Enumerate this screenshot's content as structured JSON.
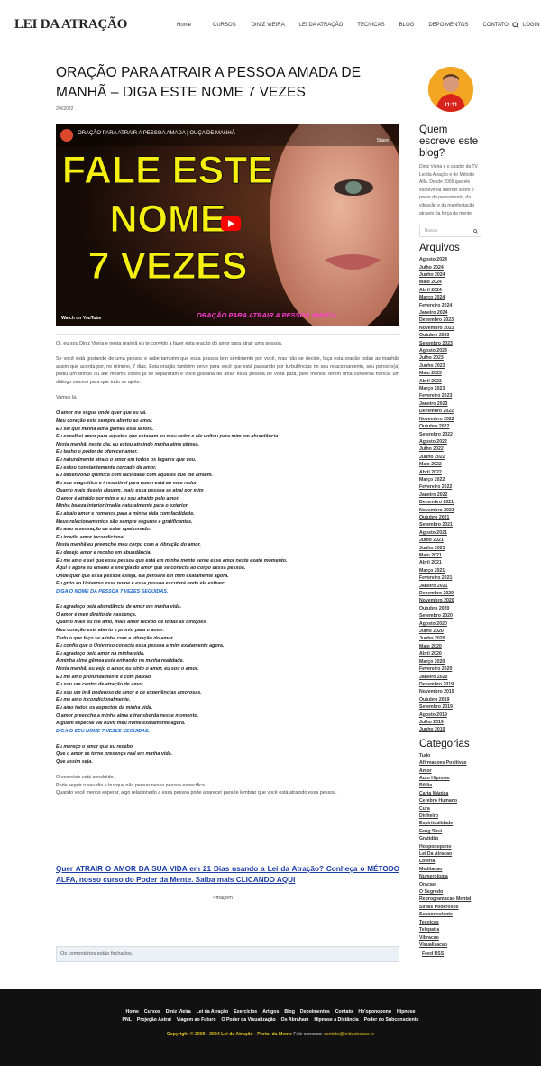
{
  "header": {
    "logo": "LEI DA ATRAÇÃO",
    "nav": [
      "Home",
      "CURSOS",
      "DINIZ VIEIRA",
      "LEI DA ATRAÇÃO",
      "TECNICAS",
      "BLOG",
      "DEPOIMENTOS",
      "CONTATO",
      "LOGIN"
    ],
    "search_icon": "search-icon"
  },
  "article": {
    "title": "ORAÇÃO PARA ATRAIR A PESSOA AMADA DE MANHÃ – DIGA ESTE NOME 7 VEZES",
    "date": "2/4/2022",
    "video": {
      "channel_title": "ORAÇÃO PARA ATRAIR A PESSOA AMADA | OUÇA DE MANHÃ",
      "share": "Share",
      "big_lines": [
        "FALE ESTE",
        "NOME",
        "7 VEZES"
      ],
      "watch_on": "Watch on",
      "youtube": "YouTube",
      "subtitle": "ORAÇÃO PARA ATRAIR A PESSOA AMADA"
    },
    "paragraphs": [
      "Oi, eu sou Diniz Vieira e nesta manhã eu te convido a fazer esta oração do amor para atrair uma pessoa.",
      "Se você está gostando de uma pessoa e sabe também que essa pessoa tem sentimento por você, mas não se decide, faça esta oração todas as manhãs assim que acorda por, no mínimo, 7 dias. Esta oração também serve para você que está passando por turbulências no seu relacionamento, seu parceiro(a) pediu um tempo ou até mesmo vocês já se separaram e você gostaria de atrair essa pessoa de volta para, pelo menos, terem uma conversa franca, um diálogo sincero para que tudo se ajeite.",
      "Vamos lá."
    ],
    "prayer1": [
      "O amor me segue onde quer que eu vá.",
      "Meu coração está sempre aberto ao amor.",
      "Eu sei que minha alma gêmea está lá fora.",
      "Eu espalhei amor para aqueles que estavam ao meu redor e ele voltou para mim em abundância.",
      "Nesta manhã, neste dia, eu estou atraindo minha alma gêmea.",
      "Eu tenho o poder de oferecer amor.",
      "Eu naturalmente atraio o amor em todos os lugares que vou.",
      "Eu estou constantemente cercado de amor.",
      "Eu desenvolvo química com facilidade com aqueles que me atraem.",
      "Eu sou magnético e irresistível para quem está ao meu redor.",
      "Quanto mais desejo alguém, mais essa pessoa se atrai por mim",
      "O amor é atraído por mim e eu sou atraído pelo amor.",
      "Minha beleza interior irradia naturalmente para o exterior.",
      "Eu atraio amor e romance para a minha vida com facilidade.",
      "Meus relacionamentos são sempre seguros e gratificantes.",
      "Eu amo a sensação de estar apaixonado.",
      "Eu irradio amor incondicional.",
      "Nesta manhã eu preencho meu corpo com a vibração do amor.",
      "Eu desejo amor e recebo em abundância.",
      "Eu me amo e sei que essa pessoa que está em minha mente sente esse amor neste exato momento.",
      "Aqui e agora eu emano a energia do amor que se conecta ao corpo dessa pessoa.",
      "Onde quer que essa pessoa esteja, ela pensará em mim exatamente agora.",
      "Eu grito ao Universo esse nome e essa pessoa escutará onde ela estiver:"
    ],
    "prayer1_blue": "DIGA O NOME DA PESSOA 7 VEZES SEGUIDAS.",
    "prayer2": [
      "Eu agradeço pela abundância de amor em minha vida.",
      "O amor é meu direito de nascença.",
      "Quanto mais eu me amo, mais amor recebo de todas as direções.",
      "Meu coração está aberto e pronto para o amor.",
      "Tudo o que faço se alinha com a vibração do amor.",
      "Eu confio que o Universo conecta essa pessoa a mim exatamente agora.",
      "Eu agradeço pelo amor na minha vida.",
      "A minha alma gêmea está entrando na minha realidade.",
      "Nesta manhã, eu vejo o amor, eu sinto o amor, eu sou o amor.",
      "Eu me amo profundamente e com paixão.",
      "Eu sou um centro de atração de amor.",
      "Eu sou um ímã poderoso de amor e de experiências amorosas.",
      "Eu me amo incondicionalmente.",
      "Eu amo todos os aspectos da minha vida.",
      "O amor preenche a minha alma e transborda nesse momento.",
      "Alguém especial vai ouvir meu nome exatamente agora."
    ],
    "prayer2_blue": "DIGA O SEU NOME 7 VEZES SEGUIDAS.",
    "prayer3": [
      "Eu mereço o amor que eu recebo.",
      "Que o amor se torne presença real em minha vida.",
      "Que assim seja."
    ],
    "closing": [
      "O  exercício está concluído.",
      "Pode seguir o seu dia e busque não pensar nessa pessoa específica.",
      "Quando você menos esperar, algo relacionado a essa pessoa pode aparecer para te lembrar que você está atraindo essa pessoa."
    ],
    "cta": "Quer ATRAIR O AMOR DA SUA VIDA em 21 Dias usando a Lei da Atração? Conheça o MÉTODO ALFA, nosso curso do Poder da Mente. Saiba mais CLICANDO AQUI",
    "image_alt": "Imagem",
    "comments_closed": "Os comentários estão fechados."
  },
  "sidebar": {
    "author_heading": "Quem escreve este blog?",
    "author_text": "Diniz Vieira é o criador da TV Lei da Atração e do Método Alfa. Desde 2009 que ele escreve na internet sobre o poder do pensamento, da vibração e da manifestação através da força da mente.",
    "search_placeholder": "Busca",
    "archives_heading": "Arquivos",
    "archives": [
      "Agosto 2024",
      "Julho 2024",
      "Junho 2024",
      "Maio 2024",
      "Abril 2024",
      "Março 2024",
      "Fevereiro 2024",
      "Janeiro 2024",
      "Dezembro 2023",
      "Novembro 2023",
      "Outubro 2023",
      "Setembro 2023",
      "Agosto 2023",
      "Julho 2023",
      "Junho 2023",
      "Maio 2023",
      "Abril 2023",
      "Março 2023",
      "Fevereiro 2023",
      "Janeiro 2023",
      "Dezembro 2022",
      "Novembro 2022",
      "Outubro 2022",
      "Setembro 2022",
      "Agosto 2022",
      "Julho 2022",
      "Junho 2022",
      "Maio 2022",
      "Abril 2022",
      "Março 2022",
      "Fevereiro 2022",
      "Janeiro 2022",
      "Dezembro 2021",
      "Novembro 2021",
      "Outubro 2021",
      "Setembro 2021",
      "Agosto 2021",
      "Julho 2021",
      "Junho 2021",
      "Maio 2021",
      "Abril 2021",
      "Março 2021",
      "Fevereiro 2021",
      "Janeiro 2021",
      "Dezembro 2020",
      "Novembro 2020",
      "Outubro 2020",
      "Setembro 2020",
      "Agosto 2020",
      "Julho 2020",
      "Junho 2020",
      "Maio 2020",
      "Abril 2020",
      "Março 2020",
      "Fevereiro 2020",
      "Janeiro 2020",
      "Dezembro 2019",
      "Novembro 2019",
      "Outubro 2019",
      "Setembro 2019",
      "Agosto 2019",
      "Julho 2019",
      "Junho 2019"
    ],
    "categories_heading": "Categorias",
    "categories": [
      "Tudo",
      "Afirmacoes Positivas",
      "Amor",
      "Auto Hipnose",
      "Bíblia",
      "Carta Mágica",
      "Cerebro Humano",
      "Cura",
      "Dinheiro",
      "Espiritualidade",
      "Feng Shui",
      "Gratidão",
      "Hooponopono",
      "Lei Da Atracao",
      "Loteria",
      "Meditacao",
      "Numerologia",
      "Oracao",
      "O Segredo",
      "Reprogramacao Mental",
      "Sinais Poderosos",
      "Subconsciente",
      "Tecnicas",
      "Telepatia",
      "Vibracao",
      "Visualizacao"
    ],
    "feed": "Feed RSS"
  },
  "footer": {
    "row1": [
      "Home",
      "Cursos",
      "Diniz Vieira",
      "Lei da Atração",
      "Exercícios",
      "Artigos",
      "Blog",
      "Depoimentos",
      "Contato",
      "Ho'oponopono",
      "Hipnose"
    ],
    "row2": [
      "PNL",
      "Projeção Astral",
      "Viagem ao Futuro",
      "O Poder da Visualização",
      "Os Abraham",
      "Hipnose à Distância",
      "Poder do Subconsciente"
    ],
    "copyright": "Copyright © 2009 - 2024 Lei da Atração - Portal da Mente",
    "contact_label": "Fale conosco:",
    "contact_email": "contato@leidaatracao.tv",
    "copyright_color": "#e0c020"
  }
}
